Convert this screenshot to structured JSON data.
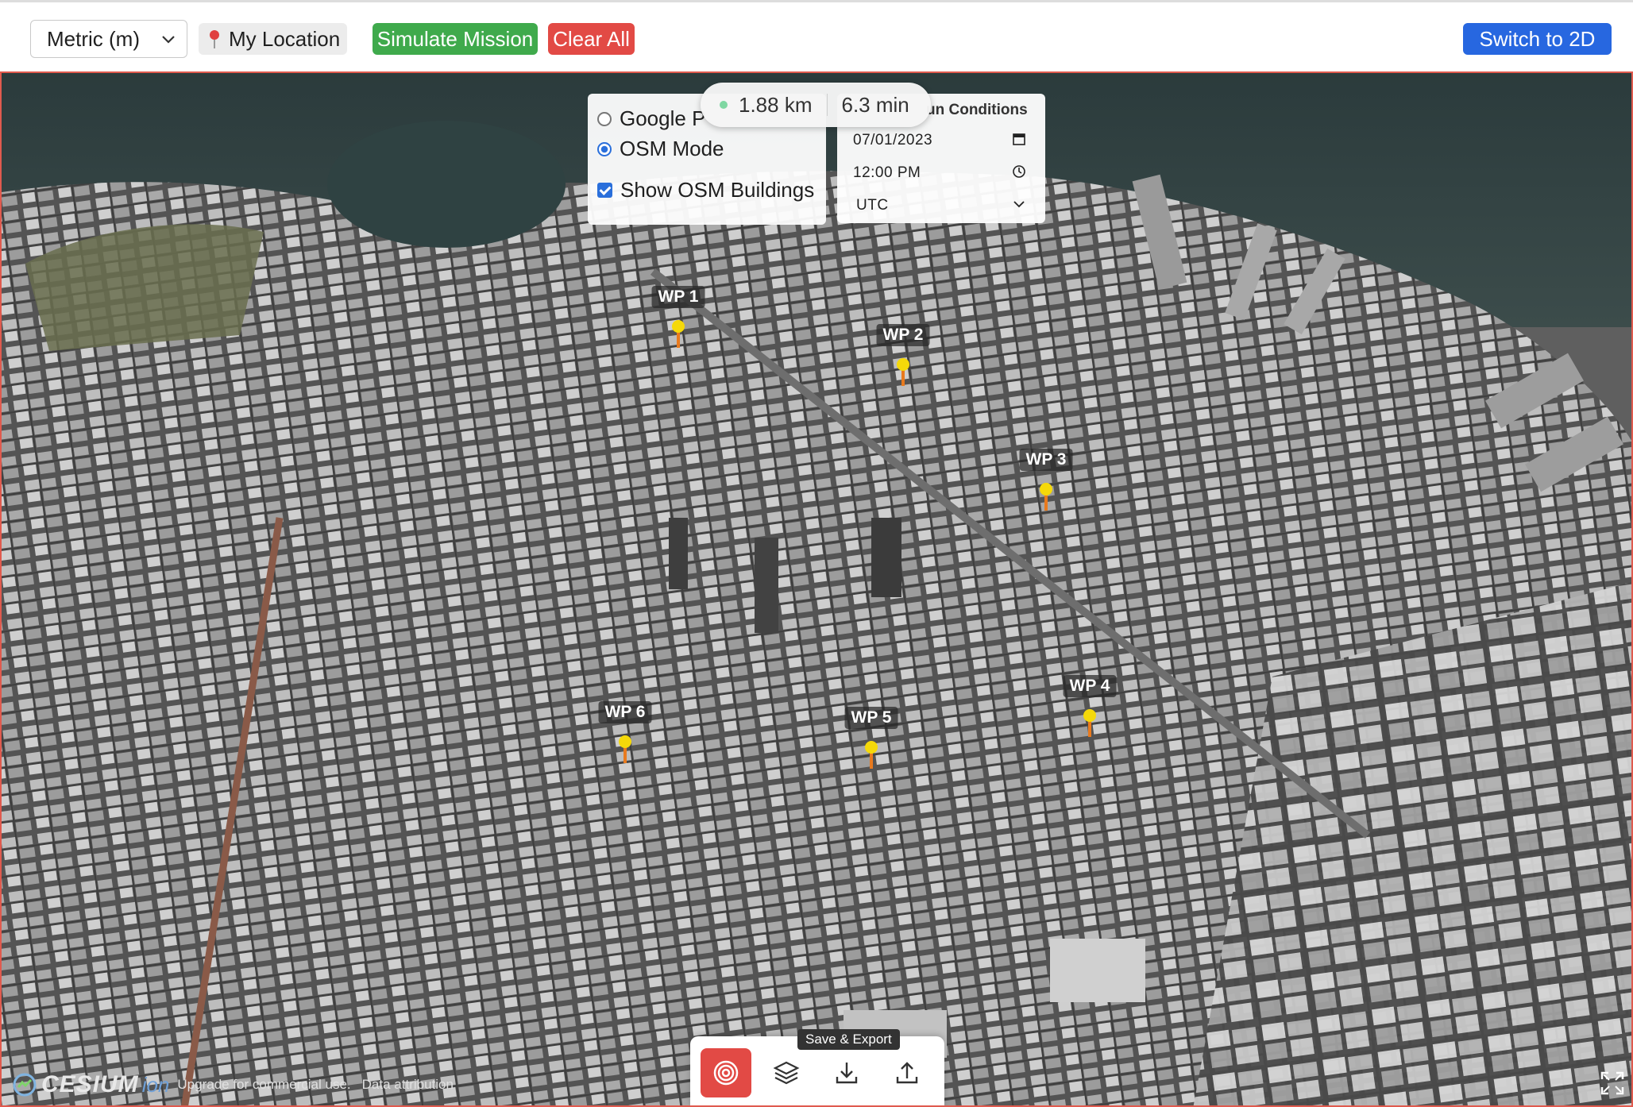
{
  "toolbar": {
    "units_select": "Metric (m)",
    "my_location": "My Location",
    "simulate": "Simulate Mission",
    "clear": "Clear All",
    "switch_view": "Switch to 2D"
  },
  "mode_panel": {
    "google_mode": "Google P",
    "osm_mode": "OSM Mode",
    "show_osm_buildings": "Show OSM Buildings"
  },
  "sun_panel": {
    "title": "un Conditions",
    "date": "07/01/2023",
    "time": "12:00  PM",
    "timezone": "UTC"
  },
  "stats": {
    "distance": "1.88 km",
    "duration": "6.3 min"
  },
  "waypoints": [
    {
      "label": "WP 1"
    },
    {
      "label": "WP 2"
    },
    {
      "label": "WP 3"
    },
    {
      "label": "WP 4"
    },
    {
      "label": "WP 5"
    },
    {
      "label": "WP 6"
    }
  ],
  "bottom_bar": {
    "tooltip": "Save & Export"
  },
  "credits": {
    "logo": "CESIUM",
    "ion": "ion",
    "upgrade": "Upgrade for commercial use.",
    "attribution": "Data attribution"
  },
  "colors": {
    "simulate_green": "#3faa4c",
    "clear_red": "#e24a45",
    "switch_blue": "#2767e0",
    "waypoint_yellow": "#f5d90a",
    "waypoint_stem": "#e87a1e"
  }
}
